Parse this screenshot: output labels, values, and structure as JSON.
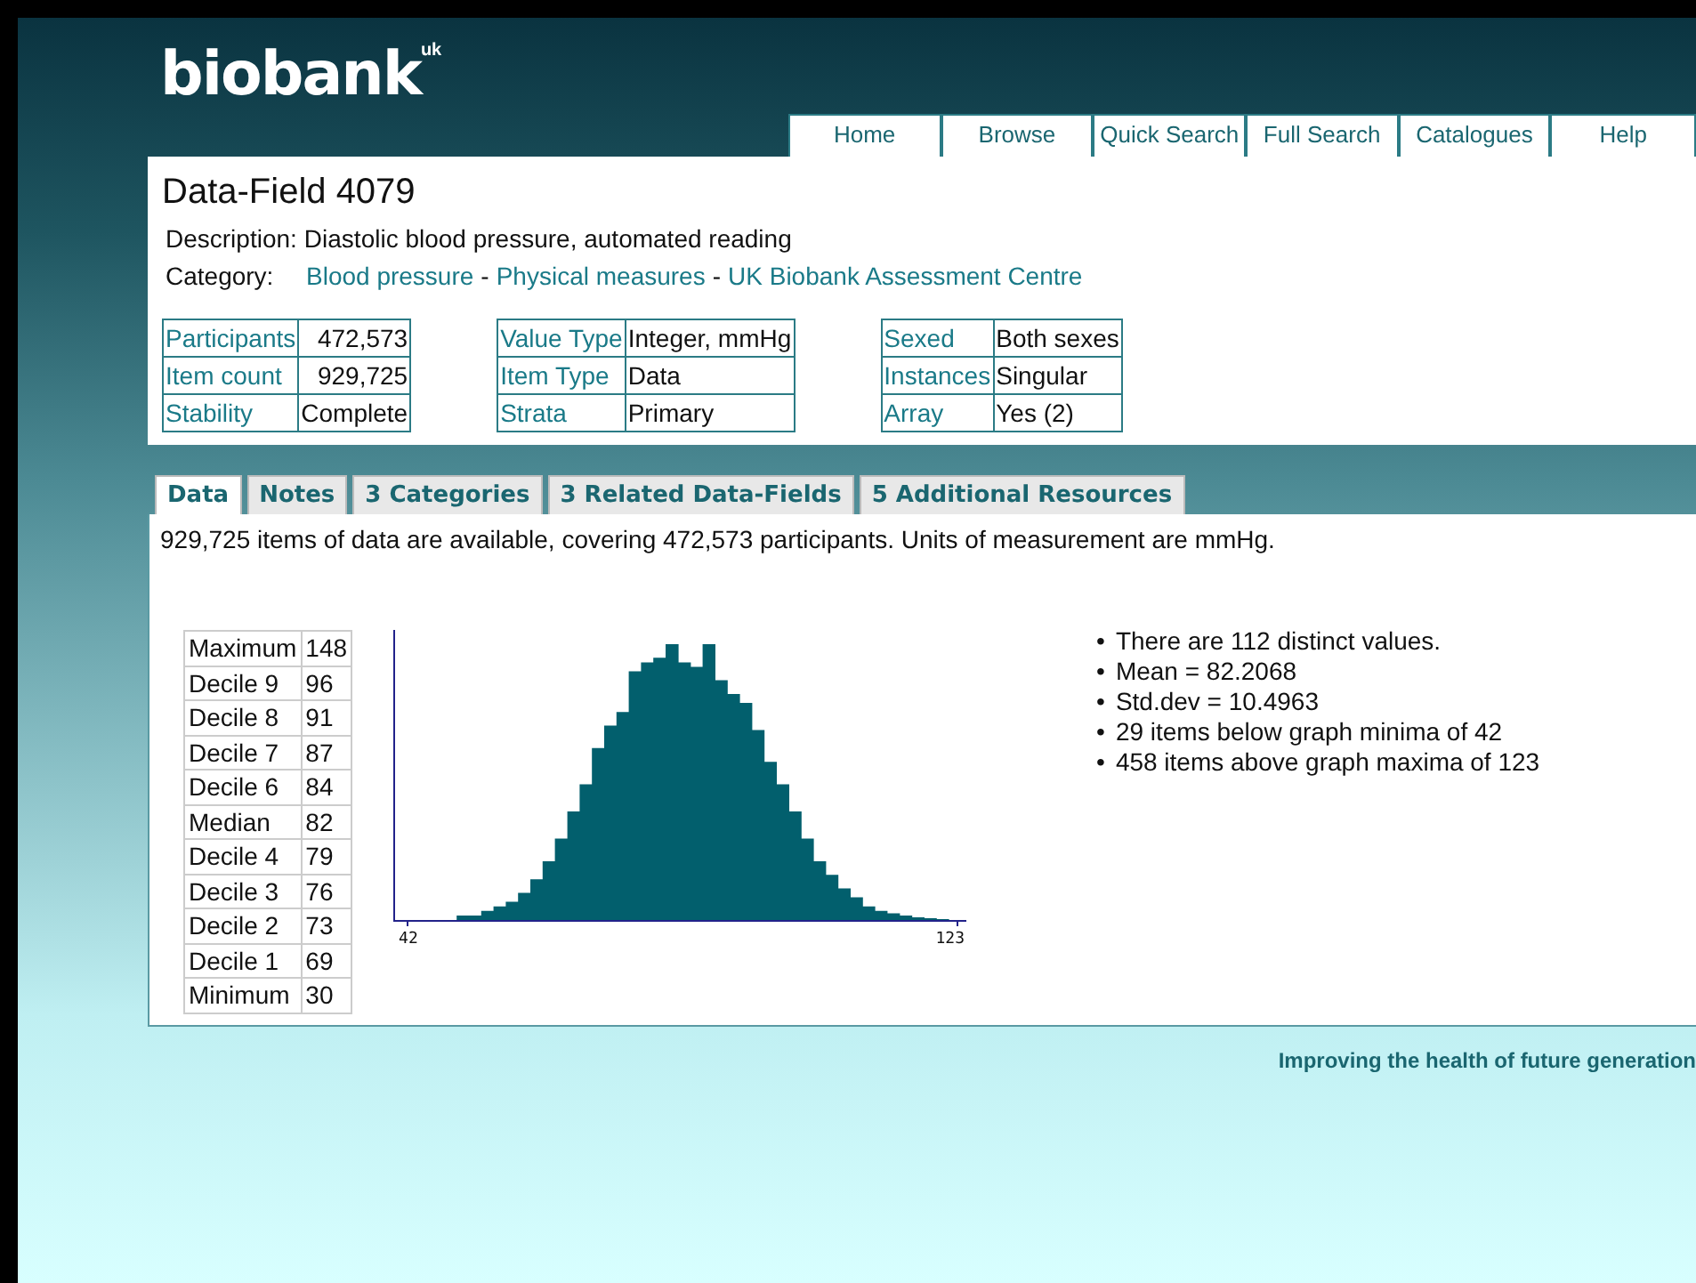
{
  "logo": {
    "name": "biobank",
    "suffix": "uk"
  },
  "nav": [
    {
      "label": "Home"
    },
    {
      "label": "Browse"
    },
    {
      "label": "Quick Search"
    },
    {
      "label": "Full Search"
    },
    {
      "label": "Catalogues"
    },
    {
      "label": "Help"
    }
  ],
  "field": {
    "title": "Data-Field 4079",
    "description_label": "Description:",
    "description": "Diastolic blood pressure, automated reading",
    "category_label": "Category:",
    "categories": [
      "Blood pressure",
      "Physical measures",
      "UK Biobank Assessment Centre"
    ],
    "category_separator": "-"
  },
  "info_tables": [
    [
      {
        "label": "Participants",
        "value": "472,573"
      },
      {
        "label": "Item count",
        "value": "929,725"
      },
      {
        "label": "Stability",
        "value": "Complete"
      }
    ],
    [
      {
        "label": "Value Type",
        "value": "Integer, mmHg"
      },
      {
        "label": "Item Type",
        "value": "Data"
      },
      {
        "label": "Strata",
        "value": "Primary"
      }
    ],
    [
      {
        "label": "Sexed",
        "value": "Both sexes"
      },
      {
        "label": "Instances",
        "value": "Singular"
      },
      {
        "label": "Array",
        "value": "Yes (2)"
      }
    ]
  ],
  "tabs": [
    {
      "label": "Data",
      "selected": true
    },
    {
      "label": "Notes",
      "selected": false
    },
    {
      "label": "3 Categories",
      "selected": false
    },
    {
      "label": "3 Related Data-Fields",
      "selected": false
    },
    {
      "label": "5 Additional Resources",
      "selected": false
    }
  ],
  "summary": "929,725 items of data are available, covering 472,573 participants. Units of measurement are mmHg.",
  "quantiles": [
    {
      "label": "Maximum",
      "value": "148"
    },
    {
      "label": "Decile 9",
      "value": "96"
    },
    {
      "label": "Decile 8",
      "value": "91"
    },
    {
      "label": "Decile 7",
      "value": "87"
    },
    {
      "label": "Decile 6",
      "value": "84"
    },
    {
      "label": "Median",
      "value": "82"
    },
    {
      "label": "Decile 4",
      "value": "79"
    },
    {
      "label": "Decile 3",
      "value": "76"
    },
    {
      "label": "Decile 2",
      "value": "73"
    },
    {
      "label": "Decile 1",
      "value": "69"
    },
    {
      "label": "Minimum",
      "value": "30"
    }
  ],
  "histogram": {
    "x_min_label": "42",
    "x_max_label": "123"
  },
  "facts": [
    {
      "bullet": "•",
      "text": "There are 112 distinct values."
    },
    {
      "bullet": "•",
      "text": "Mean = 82.2068"
    },
    {
      "bullet": "•",
      "text": "Std.dev = 10.4963"
    },
    {
      "bullet": "•",
      "text": "29 items below graph minima of 42"
    },
    {
      "bullet": "•",
      "text": "458 items above graph maxima of 123"
    }
  ],
  "footer": "Improving the health of future generation"
}
